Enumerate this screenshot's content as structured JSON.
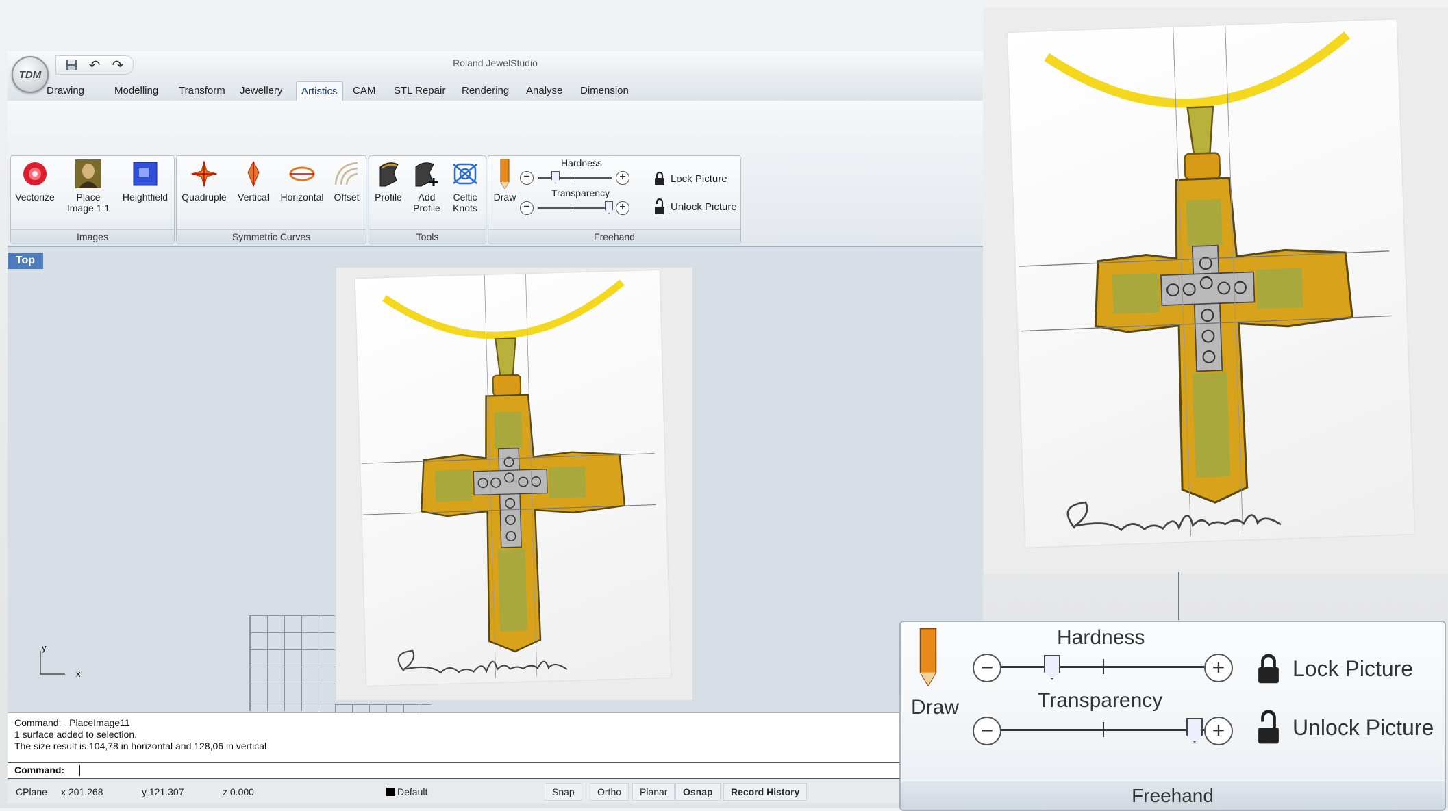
{
  "app": {
    "title": "Roland JewelStudio",
    "logo_text": "TDM"
  },
  "tabs": [
    "Drawing",
    "Modelling",
    "Transform",
    "Jewellery",
    "Artistics",
    "CAM",
    "STL Repair",
    "Rendering",
    "Analyse",
    "Dimension"
  ],
  "active_tab": "Artistics",
  "ribbon": {
    "images": {
      "label": "Images",
      "vectorize": "Vectorize",
      "place_image_1": "Place",
      "place_image_2": "Image 1:1",
      "heightfield": "Heightfield"
    },
    "symmetric": {
      "label": "Symmetric Curves",
      "quadruple": "Quadruple",
      "vertical": "Vertical",
      "horizontal": "Horizontal",
      "offset": "Offset"
    },
    "tools": {
      "label": "Tools",
      "profile": "Profile",
      "add_profile_1": "Add",
      "add_profile_2": "Profile",
      "celtic_1": "Celtic",
      "celtic_2": "Knots"
    },
    "freehand": {
      "label": "Freehand",
      "draw": "Draw",
      "hardness": "Hardness",
      "transparency": "Transparency",
      "lock": "Lock Picture",
      "unlock": "Unlock Picture",
      "hardness_level": 0.2,
      "transparency_level": 0.88
    }
  },
  "viewport": {
    "name": "Top",
    "axis_y": "y",
    "axis_x": "x"
  },
  "command": {
    "history": [
      "Command: _PlaceImage11",
      "1 surface added to selection.",
      "The size result is 104,78 in horizontal and 128,06 in vertical"
    ],
    "prompt": "Command:"
  },
  "status": {
    "cplane": "CPlane",
    "x": "x 201.268",
    "y": "y 121.307",
    "z": "z 0.000",
    "layer": "Default",
    "snap": "Snap",
    "ortho": "Ortho",
    "planar": "Planar",
    "osnap": "Osnap",
    "record_history": "Record History"
  },
  "colors": {
    "accent": "#4f7cbc",
    "gold": "#d9a21b",
    "olive": "#a6a53a",
    "chain": "#f3da1c"
  }
}
